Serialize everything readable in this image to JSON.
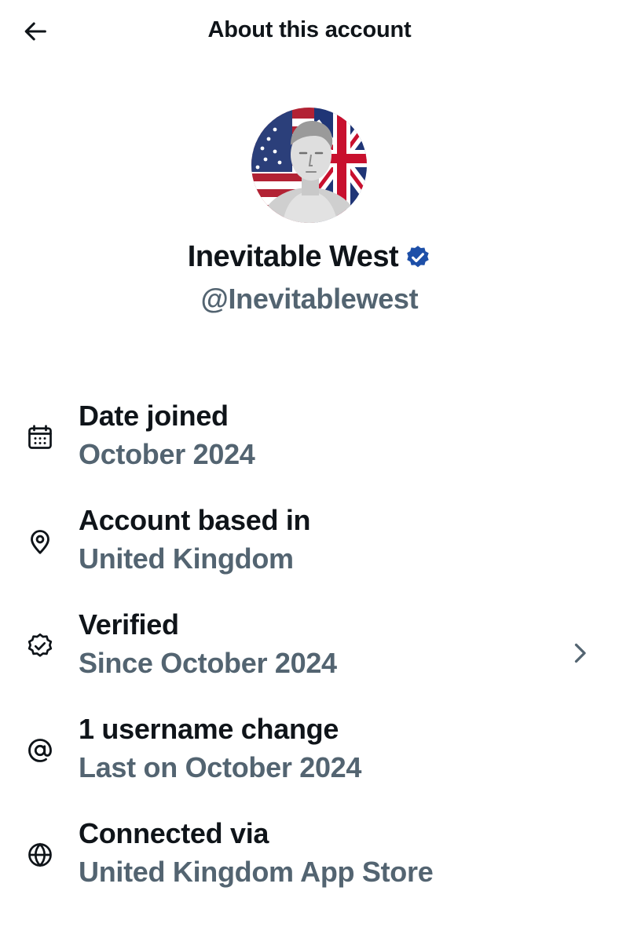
{
  "header": {
    "title": "About this account"
  },
  "profile": {
    "display_name": "Inevitable West",
    "handle": "@Inevitablewest"
  },
  "info": [
    {
      "icon": "calendar-icon",
      "label": "Date joined",
      "value": "October 2024"
    },
    {
      "icon": "location-pin-icon",
      "label": "Account based in",
      "value": "United Kingdom"
    },
    {
      "icon": "verified-badge-icon",
      "label": "Verified",
      "value": "Since October 2024"
    },
    {
      "icon": "at-sign-icon",
      "label": "1 username change",
      "value": "Last on October 2024"
    },
    {
      "icon": "globe-icon",
      "label": "Connected via",
      "value": "United Kingdom App Store"
    }
  ],
  "colors": {
    "primary_text": "#0f1419",
    "secondary_text": "#536471",
    "verified_blue": "#1d4fa8",
    "background": "#ffffff"
  }
}
